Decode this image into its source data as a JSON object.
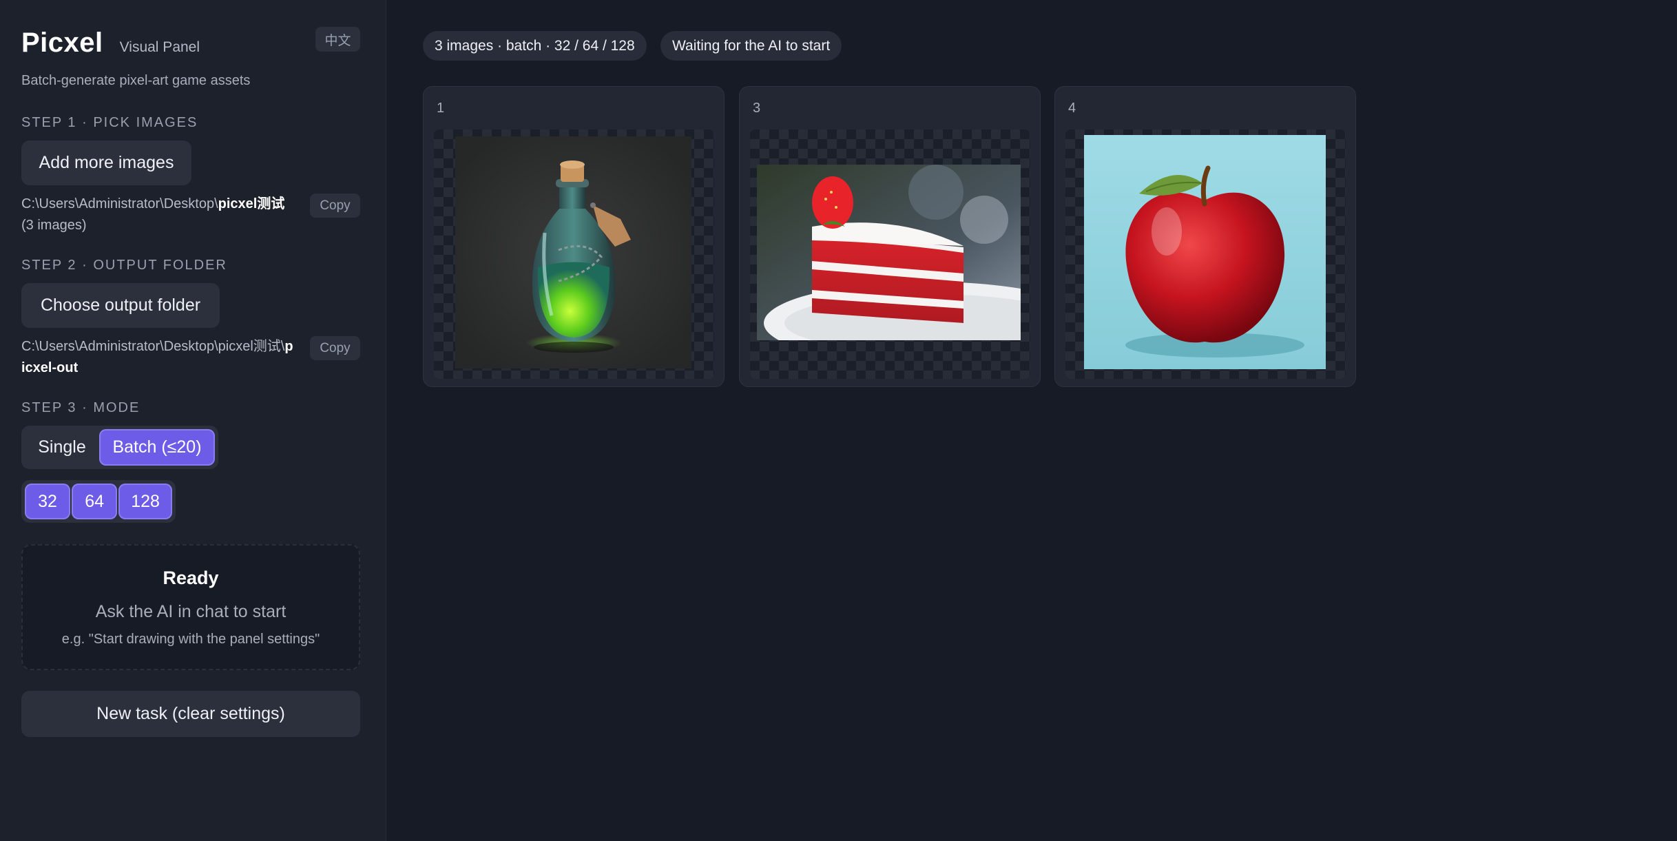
{
  "app": {
    "title": "Picxel",
    "subtitle": "Visual Panel",
    "lang_button": "中文",
    "tagline": "Batch-generate pixel-art game assets"
  },
  "step1": {
    "label": "STEP 1 · PICK IMAGES",
    "button": "Add more images",
    "path_prefix": "C:\\Users\\Administrator\\Desktop\\",
    "path_bold": "picxel测试",
    "path_suffix": " (3 images)",
    "copy": "Copy"
  },
  "step2": {
    "label": "STEP 2 · OUTPUT FOLDER",
    "button": "Choose output folder",
    "path_prefix": "C:\\Users\\Administrator\\Desktop\\picxel测试\\",
    "path_bold": "picxel-out",
    "copy": "Copy"
  },
  "step3": {
    "label": "STEP 3 · MODE",
    "modes": [
      "Single",
      "Batch (≤20)"
    ],
    "active_mode": "Batch (≤20)",
    "sizes": [
      "32",
      "64",
      "128"
    ]
  },
  "status": {
    "title": "Ready",
    "line": "Ask the AI in chat to start",
    "hint": "e.g. \"Start drawing with the panel settings\""
  },
  "new_task": "New task (clear settings)",
  "topbar": {
    "summary": "3 images · batch · 32 / 64 / 128",
    "state": "Waiting for the AI to start"
  },
  "cards": [
    {
      "index": "1",
      "image": "potion-bottle"
    },
    {
      "index": "3",
      "image": "red-velvet-cake"
    },
    {
      "index": "4",
      "image": "red-apple"
    }
  ],
  "colors": {
    "accent": "#6c5ce7",
    "background": "#171b25",
    "sidebar": "#1d212c"
  }
}
